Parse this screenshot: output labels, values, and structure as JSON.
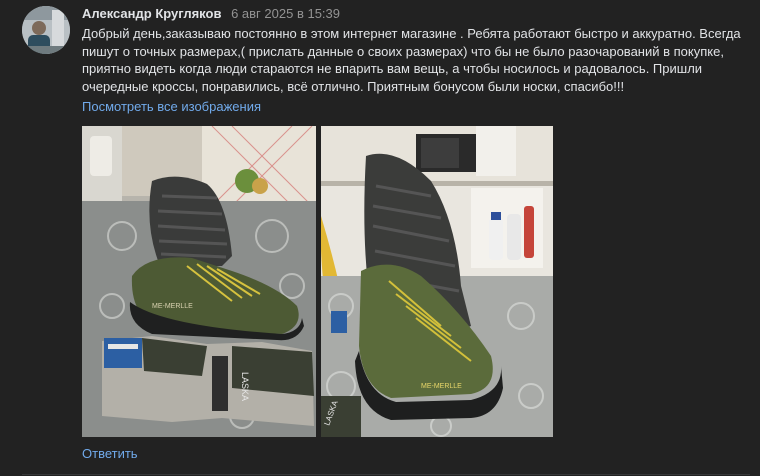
{
  "review": {
    "author": "Александр Кругляков",
    "date": "6 авг 2025 в 15:39",
    "text": "Добрый день,заказываю постоянно в этом интернет магазине . Ребята работают быстро и аккуратно. Всегда пишут о точных размерах,( прислать данные о своих размерах) что бы не было разочарований в покупке, приятно видеть когда люди стараются не впарить вам вещь, а чтобы носилось и радовалось. Пришли очередные кроссы, понравились, всё отлично. Приятным бонусом были носки, спасибо!!!",
    "show_all_images": "Посмотреть все изображения",
    "reply_label": "Ответить"
  },
  "photos": [
    {
      "shoe_brand": "ME-MERLLE",
      "sock_brand": "LASKA"
    },
    {
      "shoe_brand": "ME-MERLLE",
      "sock_brand": "LASKA"
    }
  ],
  "colors": {
    "background": "#222222",
    "link": "#71aaeb",
    "secondary_text": "#939393"
  }
}
